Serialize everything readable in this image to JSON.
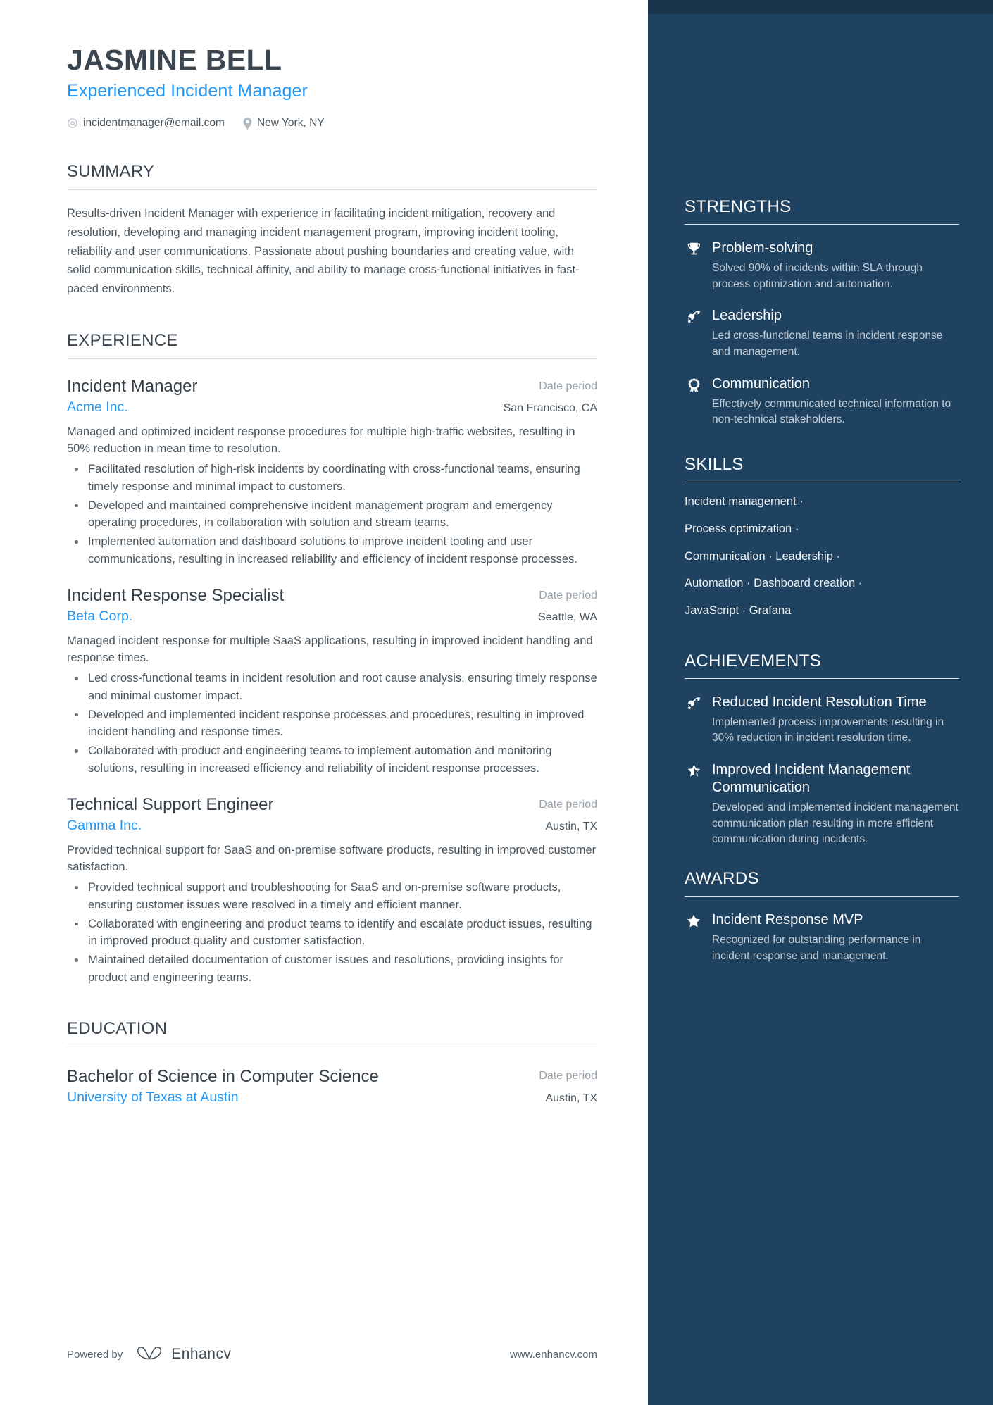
{
  "header": {
    "name": "JASMINE BELL",
    "headline": "Experienced Incident Manager",
    "contacts": [
      {
        "icon": "at-icon",
        "text": "incidentmanager@email.com"
      },
      {
        "icon": "location-pin-icon",
        "text": "New York, NY"
      }
    ]
  },
  "summary": {
    "title": "SUMMARY",
    "text": "Results-driven Incident Manager with experience in facilitating incident mitigation, recovery and resolution, developing and managing incident management program, improving incident tooling, reliability and user communications. Passionate about pushing boundaries and creating value, with solid communication skills, technical affinity, and ability to manage cross-functional initiatives in fast-paced environments."
  },
  "experience": {
    "title": "EXPERIENCE",
    "entries": [
      {
        "role": "Incident Manager",
        "date": "Date period",
        "company": "Acme Inc.",
        "location": "San Francisco, CA",
        "description": "Managed and optimized incident response procedures for multiple high-traffic websites, resulting in 50% reduction in mean time to resolution.",
        "bullets": [
          "Facilitated resolution of high-risk incidents by coordinating with cross-functional teams, ensuring timely response and minimal impact to customers.",
          "Developed and maintained comprehensive incident management program and emergency operating procedures, in collaboration with solution and stream teams.",
          "Implemented automation and dashboard solutions to improve incident tooling and user communications, resulting in increased reliability and efficiency of incident response processes."
        ]
      },
      {
        "role": "Incident Response Specialist",
        "date": "Date period",
        "company": "Beta Corp.",
        "location": "Seattle, WA",
        "description": "Managed incident response for multiple SaaS applications, resulting in improved incident handling and response times.",
        "bullets": [
          "Led cross-functional teams in incident resolution and root cause analysis, ensuring timely response and minimal customer impact.",
          "Developed and implemented incident response processes and procedures, resulting in improved incident handling and response times.",
          "Collaborated with product and engineering teams to implement automation and monitoring solutions, resulting in increased efficiency and reliability of incident response processes."
        ]
      },
      {
        "role": "Technical Support Engineer",
        "date": "Date period",
        "company": "Gamma Inc.",
        "location": "Austin, TX",
        "description": "Provided technical support for SaaS and on-premise software products, resulting in improved customer satisfaction.",
        "bullets": [
          "Provided technical support and troubleshooting for SaaS and on-premise software products, ensuring customer issues were resolved in a timely and efficient manner.",
          "Collaborated with engineering and product teams to identify and escalate product issues, resulting in improved product quality and customer satisfaction.",
          "Maintained detailed documentation of customer issues and resolutions, providing insights for product and engineering teams."
        ]
      }
    ]
  },
  "education": {
    "title": "EDUCATION",
    "entries": [
      {
        "degree": "Bachelor of Science in Computer Science",
        "date": "Date period",
        "school": "University of Texas at Austin",
        "location": "Austin, TX"
      }
    ]
  },
  "footer": {
    "powered_by": "Powered by",
    "brand": "Enhancv",
    "brand_icon": "enhancv-logo-icon",
    "website": "www.enhancv.com"
  },
  "sidebar": {
    "strengths": {
      "title": "STRENGTHS",
      "items": [
        {
          "icon": "trophy-icon",
          "title": "Problem-solving",
          "desc": "Solved 90% of incidents within SLA through process optimization and automation."
        },
        {
          "icon": "rocket-icon",
          "title": "Leadership",
          "desc": "Led cross-functional teams in incident response and management."
        },
        {
          "icon": "award-ribbon-icon",
          "title": "Communication",
          "desc": "Effectively communicated technical information to non-technical stakeholders."
        }
      ]
    },
    "skills": {
      "title": "SKILLS",
      "lines": [
        "Incident management ·",
        "Process optimization ·",
        "Communication · Leadership ·",
        "Automation · Dashboard creation ·",
        "JavaScript · Grafana"
      ]
    },
    "achievements": {
      "title": "ACHIEVEMENTS",
      "items": [
        {
          "icon": "rocket-icon",
          "title": "Reduced Incident Resolution Time",
          "desc": "Implemented process improvements resulting in 30% reduction in incident resolution time."
        },
        {
          "icon": "star-half-icon",
          "title": "Improved Incident Management Communication",
          "desc": "Developed and implemented incident management communication plan resulting in more efficient communication during incidents."
        }
      ]
    },
    "awards": {
      "title": "AWARDS",
      "items": [
        {
          "icon": "star-icon",
          "title": "Incident Response MVP",
          "desc": "Recognized for outstanding performance in incident response and management."
        }
      ]
    }
  },
  "colors": {
    "accent_blue": "#2196f3",
    "sidebar_bg": "#1f4260",
    "sidebar_top": "#17324a",
    "text_dark": "#3b4650",
    "text_body": "#4a555e",
    "muted": "#9aa3ab"
  }
}
